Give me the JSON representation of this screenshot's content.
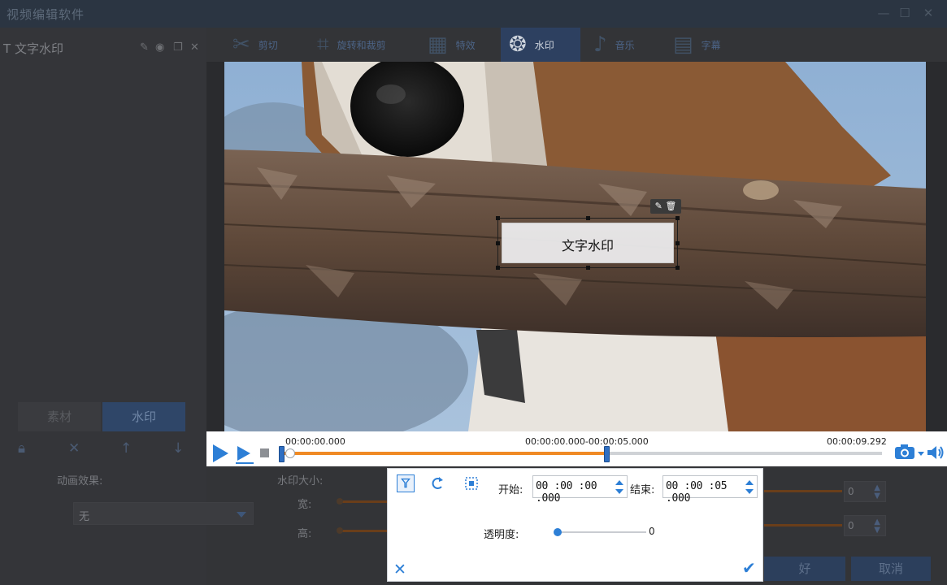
{
  "window": {
    "title": "视频编辑软件"
  },
  "left_panel": {
    "header_title": "文字水印",
    "tab_material": "素材",
    "tab_watermark": "水印"
  },
  "toolbar": {
    "tools": [
      {
        "label": "剪切",
        "icon": "scissors-icon"
      },
      {
        "label": "旋转和裁剪",
        "icon": "crop-rotate-icon"
      },
      {
        "label": "特效",
        "icon": "effects-icon"
      },
      {
        "label": "水印",
        "icon": "watermark-icon",
        "active": true
      },
      {
        "label": "音乐",
        "icon": "music-icon"
      },
      {
        "label": "字幕",
        "icon": "subtitle-icon"
      }
    ]
  },
  "preview": {
    "watermark_text": "文字水印"
  },
  "player": {
    "time_start": "00:00:00.000",
    "time_range": "00:00:00.000-00:00:05.000",
    "time_end": "00:00:09.292",
    "progress": 0.54
  },
  "settings": {
    "animation_label": "动画效果:",
    "animation_value": "无",
    "size_label": "水印大小:",
    "width_label": "宽:",
    "height_label": "高:",
    "width_value": "0",
    "height_value": "0"
  },
  "dialog": {
    "start_label": "开始:",
    "start_value": "00 :00 :00 .000",
    "end_label": "结束:",
    "end_value": "00 :00 :05 .000",
    "opacity_label": "透明度:",
    "opacity_value": "0"
  },
  "buttons": {
    "ok": "好",
    "cancel": "取消"
  },
  "colors": {
    "accent": "#2d7fd6",
    "progress": "#f08a24",
    "active_tab": "#2d4060"
  }
}
